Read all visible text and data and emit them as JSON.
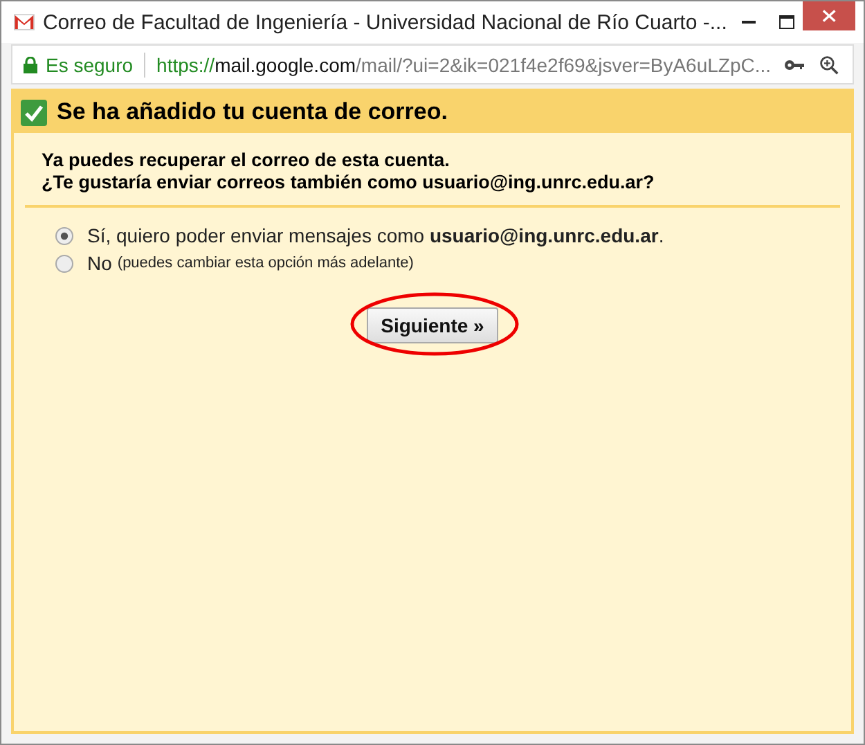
{
  "window": {
    "title": "Correo de Facultad de Ingeniería - Universidad Nacional de Río Cuarto -..."
  },
  "address_bar": {
    "security_label": "Es seguro",
    "url_scheme": "https://",
    "url_host": "mail.google.com",
    "url_path": "/mail/?ui=2&ik=021f4e2f69&jsver=ByA6uLZpC..."
  },
  "banner": {
    "checked": true,
    "title": "Se ha añadido tu cuenta de correo."
  },
  "intro": [
    "Ya puedes recuperar el correo de esta cuenta.",
    "¿Te gustaría enviar correos también como usuario@ing.unrc.edu.ar?"
  ],
  "options": [
    {
      "label": "Sí, quiero poder enviar mensajes como **usuario@ing.unrc.edu.ar**.",
      "selected": true
    },
    {
      "label": "No",
      "note": "(puedes cambiar esta opción más adelante)",
      "selected": false
    }
  ],
  "next_button": {
    "label": "Siguiente »",
    "highlighted": true
  }
}
